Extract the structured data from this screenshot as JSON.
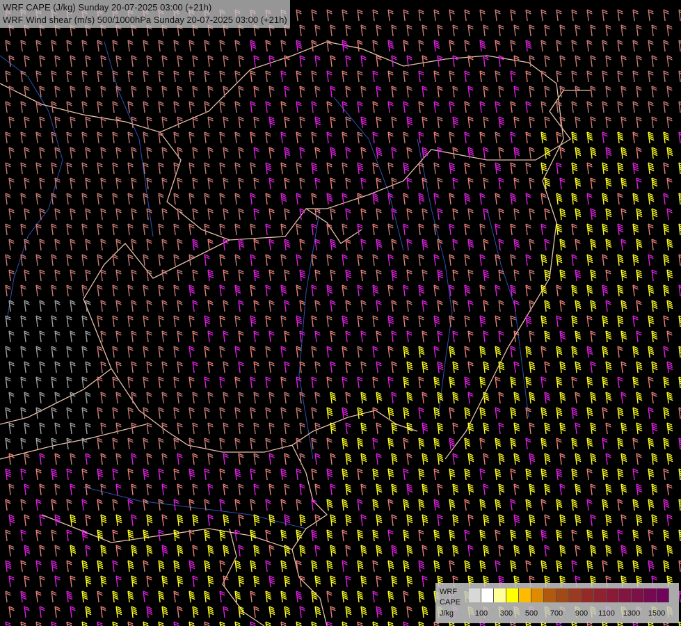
{
  "title": {
    "line1": "WRF CAPE (J/kg) Sunday 20-07-2025 03:00 (+21h)",
    "line2": "WRF Wind shear (m/s) 500/1000hPa Sunday 20-07-2025 03:00 (+21h)"
  },
  "legend": {
    "label1": "WRF",
    "label2": "CAPE",
    "label3": "J/kg",
    "colors": [
      "#d8d8d8",
      "#ffffff",
      "#ffff99",
      "#ffff00",
      "#ffbb00",
      "#e08a00",
      "#b05a10",
      "#a04a18",
      "#9a3a20",
      "#942a28",
      "#8e2230",
      "#881c38",
      "#821640",
      "#7c1048",
      "#760a50",
      "#700458"
    ],
    "tick_labels": [
      "100",
      "300",
      "500",
      "700",
      "900",
      "1100",
      "1300",
      "1500"
    ]
  },
  "barb_colors": {
    "low": "#c87c78",
    "mid": "#e8807a",
    "magenta": "#dd22dd",
    "yellow": "#ffff22",
    "gray": "#a0a0a0"
  },
  "line_colors": {
    "border": "#e8c0a8",
    "river": "#3050b0",
    "coast": "#ffffff"
  }
}
